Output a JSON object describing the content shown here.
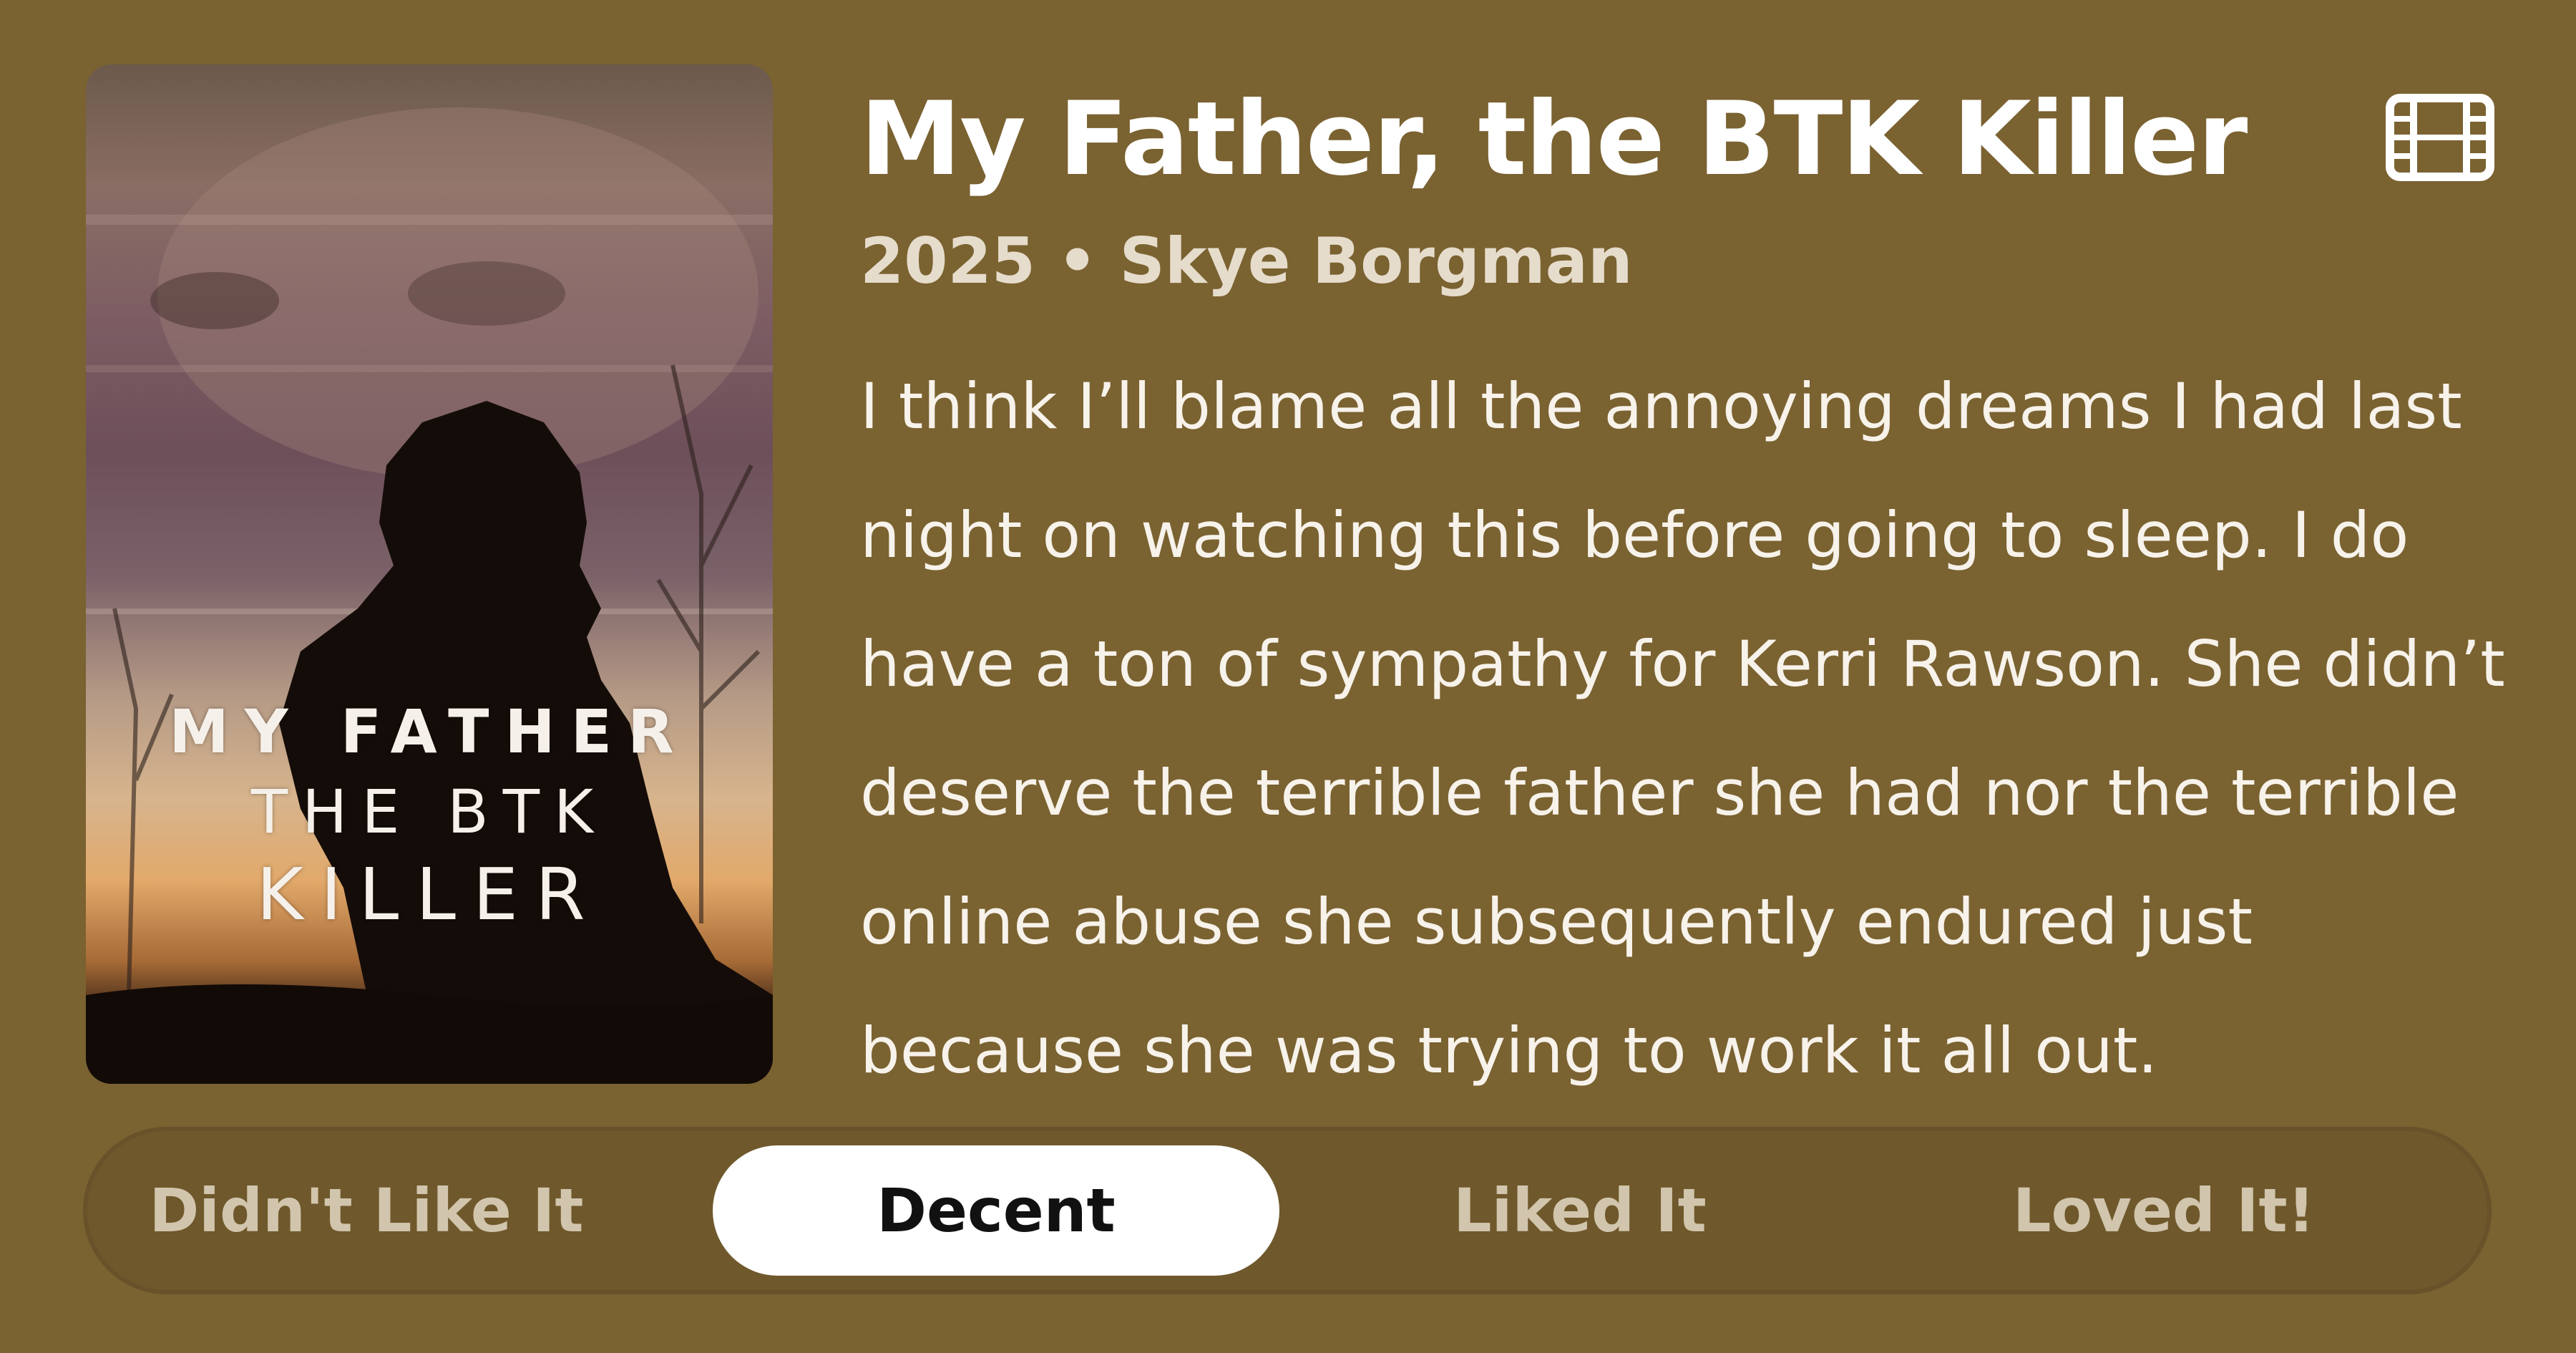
{
  "movie": {
    "title": "My Father, the BTK Killer",
    "meta": "2025 • Skye Borgman",
    "review": "I think I’ll blame all the annoying dreams I had last night on watching this before going to sleep. I do have a ton of sympathy for Kerri Rawson. She didn’t deserve the terrible father she had nor the terrible online abuse she subsequently endured just because she was trying to work it all out.",
    "type_icon": "film-icon"
  },
  "poster": {
    "line1": "MY FATHER",
    "line2": "THE BTK",
    "line3": "KILLER"
  },
  "rating": {
    "options": [
      "Didn't Like It",
      "Decent",
      "Liked It",
      "Loved It!"
    ],
    "selected": "Decent"
  },
  "colors": {
    "background": "#7a6231",
    "bar": "#6f582b",
    "selected_pill": "#ffffff"
  }
}
